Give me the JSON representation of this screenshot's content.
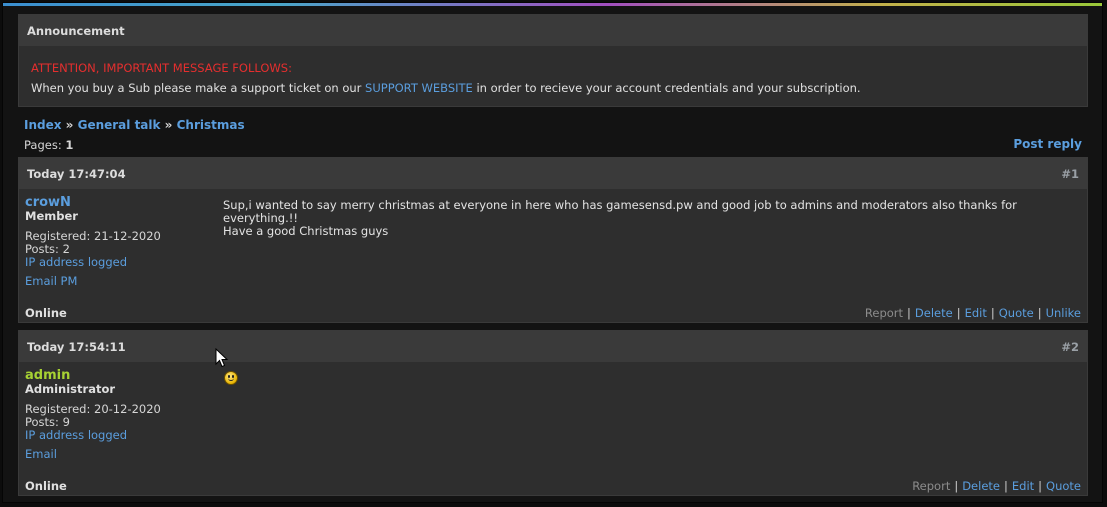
{
  "announcement": {
    "title": "Announcement",
    "alert": "ATTENTION, IMPORTANT MESSAGE FOLLOWS:",
    "text_before": "When you buy a Sub please make a support ticket on our ",
    "link": "SUPPORT WEBSITE",
    "text_after": " in order to recieve your account credentials and your subscription."
  },
  "breadcrumb": {
    "items": [
      "Index",
      "General talk",
      "Christmas"
    ],
    "sep": " » "
  },
  "pages": {
    "label": "Pages: ",
    "value": "1"
  },
  "post_reply": "Post reply",
  "posts": [
    {
      "time": "Today 17:47:04",
      "num": "#1",
      "username": "crowN",
      "role": "Member",
      "registered": "Registered: 21-12-2020",
      "posts": "Posts: 2",
      "ip": "IP address logged",
      "contact": "Email PM",
      "message_line1": "Sup,i wanted to say merry christmas at everyone in here who has gamesensd.pw and good job to admins and moderators also thanks for everything.!!",
      "message_line2": "Have a good Christmas guys",
      "status": "Online",
      "actions": {
        "report": "Report",
        "delete": "Delete",
        "edit": "Edit",
        "quote": "Quote",
        "unlike": "Unlike"
      }
    },
    {
      "time": "Today 17:54:11",
      "num": "#2",
      "username": "admin",
      "role": "Administrator",
      "registered": "Registered: 20-12-2020",
      "posts": "Posts: 9",
      "ip": "IP address logged",
      "contact": "Email",
      "message_icon": "smiley-icon",
      "status": "Online",
      "actions": {
        "report": "Report",
        "delete": "Delete",
        "edit": "Edit",
        "quote": "Quote"
      }
    }
  ],
  "separator": "|"
}
